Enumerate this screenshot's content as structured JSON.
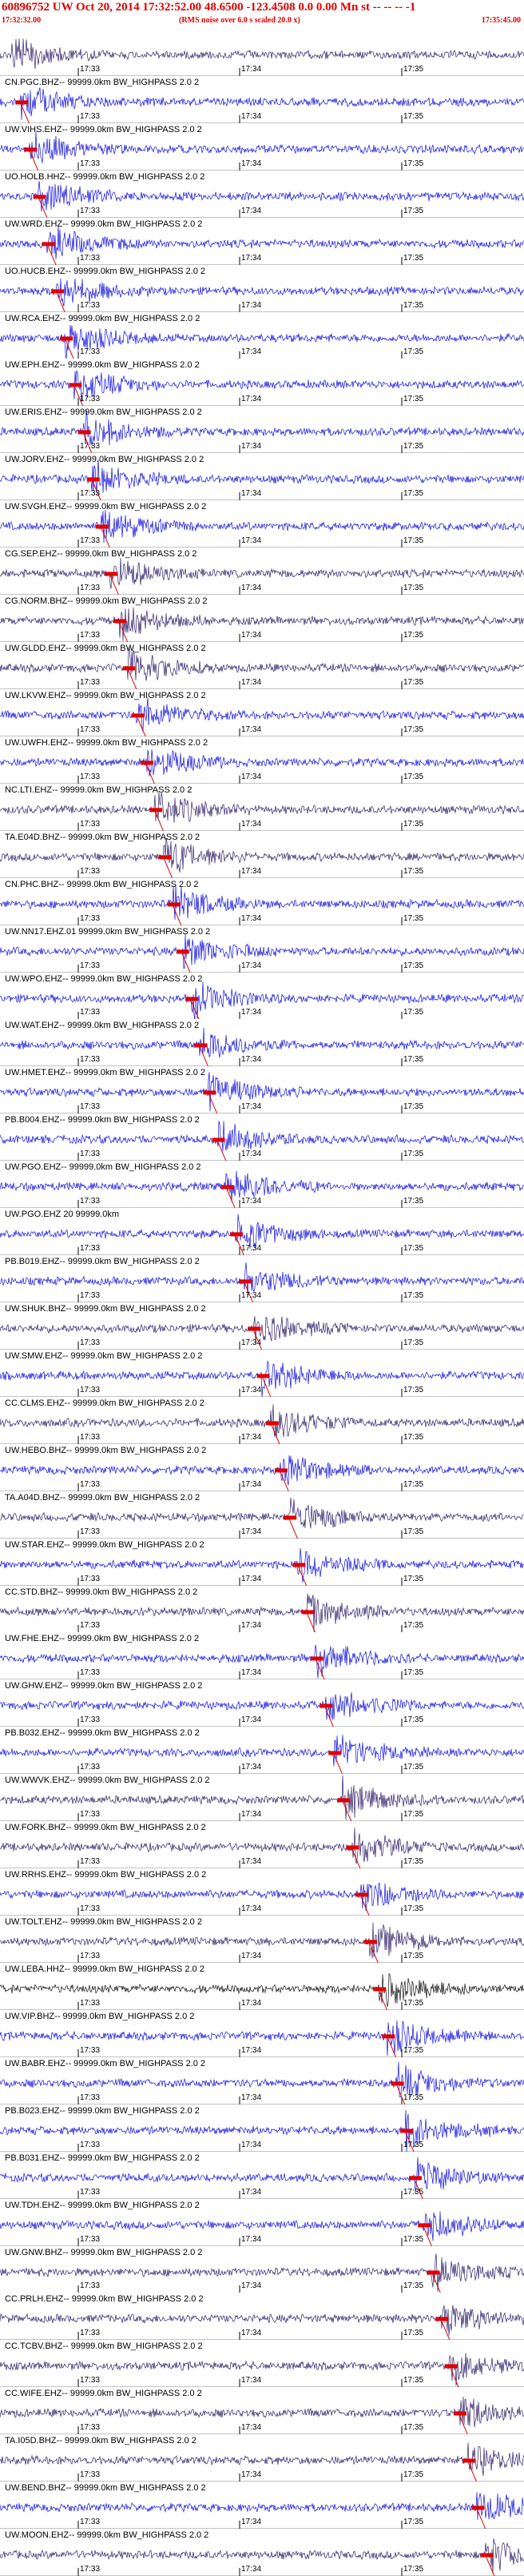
{
  "header": {
    "title": "60896752 UW Oct 20, 2014 17:32:52.00   48.6500 -123.4508  0.0 0.00 Mn st -- -- -- -1",
    "start_time": "17:32:32.00",
    "end_time": "17:35:45.00",
    "note": "(RMS noise over 6.0 s scaled 20.0 x)"
  },
  "time_ticks": [
    "17:33",
    "17:34",
    "17:35"
  ],
  "colors": {
    "blue": "#1010e0",
    "dark": "#30206a",
    "black": "#111111",
    "pick": "#e00000",
    "grid": "#000000"
  },
  "traces": [
    {
      "label": "",
      "color": "dark"
    },
    {
      "label": "CN.PGC.BHZ-- 99999.0km BW_HIGHPASS  2.0  2",
      "color": "blue"
    },
    {
      "label": "UW.VIHS.EHZ-- 99999.0km BW_HIGHPASS  2.0  2",
      "color": "blue"
    },
    {
      "label": "UO.HOLB.HHZ-- 99999.0km BW_HIGHPASS  2.0  2",
      "color": "blue"
    },
    {
      "label": "UW.WRD.EHZ-- 99999.0km BW_HIGHPASS  2.0  2",
      "color": "blue"
    },
    {
      "label": "UO.HUCB.EHZ-- 99999.0km BW_HIGHPASS  2.0  2",
      "color": "blue"
    },
    {
      "label": "UW.RCA.EHZ-- 99999.0km BW_HIGHPASS  2.0  2",
      "color": "blue"
    },
    {
      "label": "UW.EPH.EHZ-- 99999.0km BW_HIGHPASS  2.0  2",
      "color": "blue"
    },
    {
      "label": "UW.ERIS.EHZ-- 99999.0km BW_HIGHPASS  2.0  2",
      "color": "blue"
    },
    {
      "label": "UW.JORV.EHZ-- 99999.0km BW_HIGHPASS  2.0  2",
      "color": "blue"
    },
    {
      "label": "UW.SVGH.EHZ-- 99999.0km BW_HIGHPASS  2.0  2",
      "color": "blue"
    },
    {
      "label": "CG.SEP.EHZ-- 99999.0km BW_HIGHPASS  2.0  2",
      "color": "dark"
    },
    {
      "label": "CG.NORM.BHZ-- 99999.0km BW_HIGHPASS  2.0  2",
      "color": "dark"
    },
    {
      "label": "UW.GLDD.EHZ-- 99999.0km BW_HIGHPASS  2.0  2",
      "color": "dark"
    },
    {
      "label": "UW.LKVW.EHZ-- 99999.0km BW_HIGHPASS  2.0  2",
      "color": "blue"
    },
    {
      "label": "UW.UWFH.EHZ-- 99999.0km BW_HIGHPASS  2.0  2",
      "color": "blue"
    },
    {
      "label": "NC.LTI.EHZ-- 99999.0km BW_HIGHPASS  2.0  2",
      "color": "dark"
    },
    {
      "label": "TA.E04D.BHZ-- 99999.0km BW_HIGHPASS  2.0  2",
      "color": "dark"
    },
    {
      "label": "CN.PHC.BHZ-- 99999.0km BW_HIGHPASS  2.0  2",
      "color": "blue"
    },
    {
      "label": "UW.NN17.EHZ.01 99999.0km BW_HIGHPASS  2.0  2",
      "color": "blue"
    },
    {
      "label": "UW.WPO.EHZ-- 99999.0km BW_HIGHPASS  2.0  2",
      "color": "blue"
    },
    {
      "label": "UW.WAT.EHZ-- 99999.0km BW_HIGHPASS  2.0  2",
      "color": "blue"
    },
    {
      "label": "UW.HMET.EHZ-- 99999.0km BW_HIGHPASS  2.0  2",
      "color": "blue"
    },
    {
      "label": "PB.B004.EHZ-- 99999.0km BW_HIGHPASS  2.0  2",
      "color": "blue"
    },
    {
      "label": "UW.PGO.EHZ-- 99999.0km BW_HIGHPASS  2.0  2",
      "color": "blue"
    },
    {
      "label": "UW.PGO.EHZ 20 99999.0km",
      "color": "blue"
    },
    {
      "label": "PB.B019.EHZ-- 99999.0km BW_HIGHPASS  2.0  2",
      "color": "blue"
    },
    {
      "label": "UW.SHUK.BHZ-- 99999.0km BW_HIGHPASS  2.0  2",
      "color": "dark"
    },
    {
      "label": "UW.SMW.EHZ-- 99999.0km BW_HIGHPASS  2.0  2",
      "color": "blue"
    },
    {
      "label": "CC.CLMS.EHZ-- 99999.0km BW_HIGHPASS  2.0  2",
      "color": "dark"
    },
    {
      "label": "UW.HEBO.BHZ-- 99999.0km BW_HIGHPASS  2.0  2",
      "color": "blue"
    },
    {
      "label": "TA.A04D.BHZ-- 99999.0km BW_HIGHPASS  2.0  2",
      "color": "dark"
    },
    {
      "label": "UW.STAR.EHZ-- 99999.0km BW_HIGHPASS  2.0  2",
      "color": "blue"
    },
    {
      "label": "CC.STD.BHZ-- 99999.0km BW_HIGHPASS  2.0  2",
      "color": "dark"
    },
    {
      "label": "UW.FHE.EHZ-- 99999.0km BW_HIGHPASS  2.0  2",
      "color": "blue"
    },
    {
      "label": "UW.GHW.EHZ-- 99999.0km BW_HIGHPASS  2.0  2",
      "color": "blue"
    },
    {
      "label": "PB.B032.EHZ-- 99999.0km BW_HIGHPASS  2.0  2",
      "color": "blue"
    },
    {
      "label": "UW.WWVK.EHZ-- 99999.0km BW_HIGHPASS  2.0  2",
      "color": "dark"
    },
    {
      "label": "UW.FORK.BHZ-- 99999.0km BW_HIGHPASS  2.0  2",
      "color": "dark"
    },
    {
      "label": "UW.RRHS.EHZ-- 99999.0km BW_HIGHPASS  2.0  2",
      "color": "blue"
    },
    {
      "label": "UW.TOLT.EHZ-- 99999.0km BW_HIGHPASS  2.0  2",
      "color": "dark"
    },
    {
      "label": "UW.LEBA.HHZ-- 99999.0km BW_HIGHPASS  2.0  2",
      "color": "black"
    },
    {
      "label": "UW.VIP.BHZ-- 99999.0km BW_HIGHPASS  2.0  2",
      "color": "blue"
    },
    {
      "label": "UW.BABR.EHZ-- 99999.0km BW_HIGHPASS  2.0  2",
      "color": "blue"
    },
    {
      "label": "PB.B023.EHZ-- 99999.0km BW_HIGHPASS  2.0  2",
      "color": "blue"
    },
    {
      "label": "PB.B031.EHZ-- 99999.0km BW_HIGHPASS  2.0  2",
      "color": "blue"
    },
    {
      "label": "UW.TDH.EHZ-- 99999.0km BW_HIGHPASS  2.0  2",
      "color": "blue"
    },
    {
      "label": "UW.GNW.BHZ-- 99999.0km BW_HIGHPASS  2.0  2",
      "color": "dark"
    },
    {
      "label": "CC.PRLH.EHZ-- 99999.0km BW_HIGHPASS  2.0  2",
      "color": "dark"
    },
    {
      "label": "CC.TCBV.BHZ-- 99999.0km BW_HIGHPASS  2.0  2",
      "color": "dark"
    },
    {
      "label": "CC.WIFE.EHZ-- 99999.0km BW_HIGHPASS  2.0  2",
      "color": "dark"
    },
    {
      "label": "TA.I05D.BHZ-- 99999.0km BW_HIGHPASS  2.0  2",
      "color": "dark"
    },
    {
      "label": "UW.BEND.BHZ-- 99999.0km BW_HIGHPASS  2.0  2",
      "color": "blue"
    },
    {
      "label": "UW.MOON.EHZ-- 99999.0km BW_HIGHPASS  2.0  2",
      "color": "dark"
    }
  ]
}
